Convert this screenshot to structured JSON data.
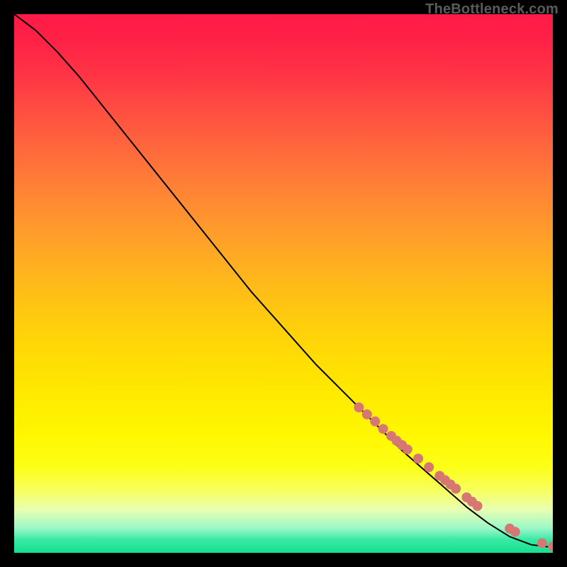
{
  "watermark": "TheBottleneck.com",
  "chart_data": {
    "type": "line",
    "title": "",
    "xlabel": "",
    "ylabel": "",
    "xlim": [
      0,
      100
    ],
    "ylim": [
      0,
      100
    ],
    "x": [
      0,
      4,
      8,
      12,
      16,
      20,
      24,
      28,
      32,
      36,
      40,
      44,
      48,
      52,
      56,
      60,
      64,
      68,
      72,
      76,
      80,
      84,
      88,
      92,
      96,
      100
    ],
    "y": [
      100,
      97,
      93,
      88.5,
      83.5,
      78.5,
      73.5,
      68.5,
      63.5,
      58.5,
      53.5,
      48.5,
      44,
      39.5,
      35,
      31,
      27,
      23,
      19,
      15.5,
      12,
      8.5,
      5.5,
      3,
      1.5,
      1
    ],
    "markers": {
      "x": [
        64,
        65.5,
        67,
        68.5,
        70,
        71,
        72,
        73,
        75,
        77,
        79,
        80,
        81,
        82,
        84,
        85,
        86,
        92,
        93,
        98,
        100
      ],
      "y": [
        27,
        25.7,
        24.4,
        23,
        21.7,
        20.8,
        20,
        19.2,
        17.5,
        15.9,
        14.3,
        13.5,
        12.7,
        11.9,
        10.3,
        9.5,
        8.7,
        4.5,
        3.9,
        1.8,
        1.2
      ],
      "color": "#d77773",
      "radius": 7
    },
    "background_gradient": {
      "stops": [
        {
          "offset": 0.0,
          "color": "#ff1a47"
        },
        {
          "offset": 0.05,
          "color": "#ff2246"
        },
        {
          "offset": 0.12,
          "color": "#ff3745"
        },
        {
          "offset": 0.2,
          "color": "#ff5640"
        },
        {
          "offset": 0.3,
          "color": "#ff7a38"
        },
        {
          "offset": 0.4,
          "color": "#ff9b2c"
        },
        {
          "offset": 0.5,
          "color": "#ffba1a"
        },
        {
          "offset": 0.6,
          "color": "#ffd408"
        },
        {
          "offset": 0.7,
          "color": "#ffe900"
        },
        {
          "offset": 0.78,
          "color": "#fff700"
        },
        {
          "offset": 0.84,
          "color": "#fcff16"
        },
        {
          "offset": 0.885,
          "color": "#f7ff60"
        },
        {
          "offset": 0.92,
          "color": "#e8ffb3"
        },
        {
          "offset": 0.955,
          "color": "#99f7c8"
        },
        {
          "offset": 0.975,
          "color": "#3aeaa5"
        },
        {
          "offset": 1.0,
          "color": "#13df90"
        }
      ]
    }
  }
}
